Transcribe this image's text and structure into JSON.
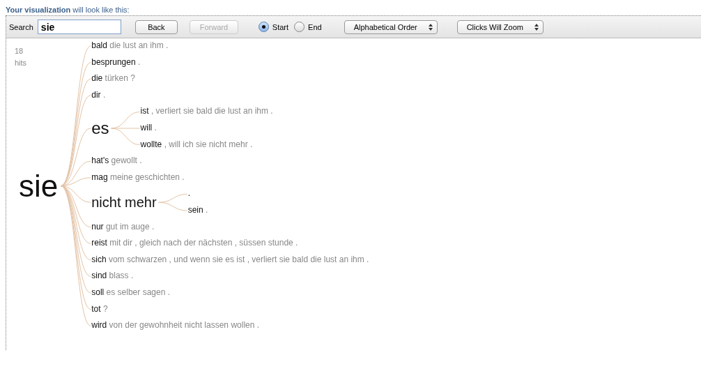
{
  "heading": "**Your visualization** will look like this:",
  "toolbar": {
    "search_label": "Search",
    "search_value": "sie",
    "back": {
      "label": "Back",
      "disabled": false
    },
    "forward": {
      "label": "Forward",
      "disabled": true
    },
    "radios": [
      {
        "label": "Start",
        "selected": true
      },
      {
        "label": "End",
        "selected": false
      }
    ],
    "selects": [
      "Alphabetical Order",
      "Clicks Will Zoom"
    ]
  },
  "hits": {
    "count": "18",
    "label": "hits"
  },
  "tree": {
    "word": "sie",
    "children": [
      {
        "word": "bald",
        "rest": "die lust an ihm ."
      },
      {
        "word": "besprungen",
        "rest": "."
      },
      {
        "word": "die",
        "rest": "türken ?"
      },
      {
        "word": "dir",
        "rest": "."
      },
      {
        "word": "es",
        "children": [
          {
            "word": "ist",
            "rest": ", verliert sie bald die lust an ihm ."
          },
          {
            "word": "will",
            "rest": "."
          },
          {
            "word": "wollte",
            "rest": ", will ich sie nicht mehr ."
          }
        ]
      },
      {
        "word": "hat's",
        "rest": "gewollt ."
      },
      {
        "word": "mag",
        "rest": "meine geschichten ."
      },
      {
        "word": "nicht mehr",
        "children": [
          {
            "word": "."
          },
          {
            "word": "sein",
            "rest": "."
          }
        ]
      },
      {
        "word": "nur",
        "rest": "gut im auge ."
      },
      {
        "word": "reist",
        "rest": "mit dir , gleich nach der nächsten , süssen stunde ."
      },
      {
        "word": "sich",
        "rest": "vom schwarzen , und wenn sie es ist , verliert sie bald die lust an ihm ."
      },
      {
        "word": "sind",
        "rest": "blass ."
      },
      {
        "word": "soll",
        "rest": "es selber sagen ."
      },
      {
        "word": "tot",
        "rest": "?"
      },
      {
        "word": "wird",
        "rest": "von der gewohnheit nicht lassen wollen ."
      }
    ]
  }
}
